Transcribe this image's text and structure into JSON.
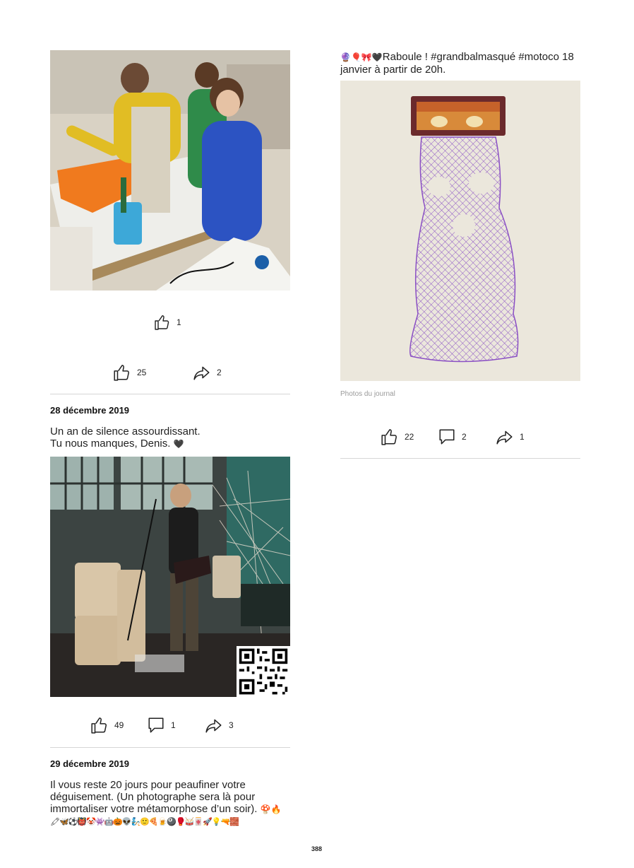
{
  "post_top_left": {
    "reactions": {
      "single_like_count": "1",
      "likes": "25",
      "shares": "2"
    }
  },
  "post_dec28": {
    "date": "28 décembre 2019",
    "text_line1": "Un an de silence assourdissant.",
    "text_line2": "Tu nous manques, Denis.",
    "text_emoji": "🖤",
    "reactions": {
      "likes": "49",
      "comments": "1",
      "shares": "3"
    }
  },
  "post_dec29": {
    "date": "29 décembre 2019",
    "text_line1": "Il vous reste 20 jours pour peaufiner votre",
    "text_line2": "déguisement. (Un photographe sera là pour",
    "text_line3": "immortaliser votre métamorphose d’un soir).",
    "emoji_line_end": "🍄🔥",
    "emoji_row": "🖍🦋⚽👹🤡👾🤖🎃👽🧞🙂🍕🍺🎱🥊🥁🀄🚀💡🔫🧱"
  },
  "post_right": {
    "emoji_prefix": "🔮🎈🎀🖤",
    "text_line1": "Raboule ! #grandbalmasqué #motoco 18",
    "text_line2": "janvier à partir de 20h.",
    "photo_caption": "Photos du journal",
    "reactions": {
      "likes": "22",
      "comments": "2",
      "shares": "1"
    }
  },
  "page_number": "388",
  "colors": {
    "separator": "#d6d6d6",
    "caption": "#9a9a9a",
    "mask_net": "#8a4fc4"
  },
  "icons": [
    "thumbs-up-icon",
    "comment-icon",
    "share-icon",
    "qr-code-icon"
  ]
}
